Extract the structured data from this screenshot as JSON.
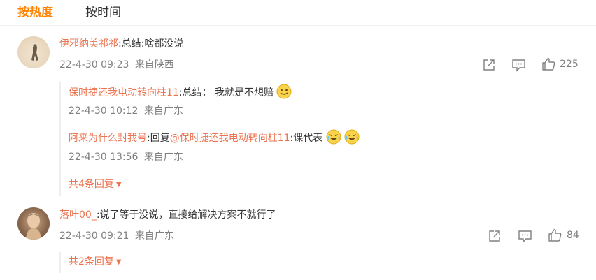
{
  "tabs": {
    "hot": "按热度",
    "time": "按时间"
  },
  "comments": [
    {
      "user": "伊邪纳美祁祁",
      "sep": ":",
      "text": "总结:啥都没说",
      "time": "22-4-30 09:23",
      "source": "来自陕西",
      "likes": "225",
      "replies": [
        {
          "user": "保时捷还我电动转向柱11",
          "sep": ":",
          "text": "总结：  我就是不想赔",
          "time": "22-4-30 10:12",
          "source": "来自广东"
        },
        {
          "user": "阿来为什么封我号",
          "sep": ":",
          "reply_word": "回复",
          "mention": "@保时捷还我电动转向柱11",
          "sep2": ":",
          "text": "课代表",
          "time": "22-4-30 13:56",
          "source": "来自广东"
        }
      ],
      "more": "共4条回复"
    },
    {
      "user": "落叶00_",
      "sep": ":",
      "text": "说了等于没说，直接给解决方案不就行了",
      "time": "22-4-30 09:21",
      "source": "来自广东",
      "likes": "84",
      "more": "共2条回复"
    }
  ],
  "colors": {
    "accent": "#ff8200",
    "username": "#eb7350",
    "meta": "#808080"
  },
  "icons": [
    "share-icon",
    "comment-icon",
    "like-icon",
    "smile-emoji",
    "laugh-cry-emoji"
  ]
}
